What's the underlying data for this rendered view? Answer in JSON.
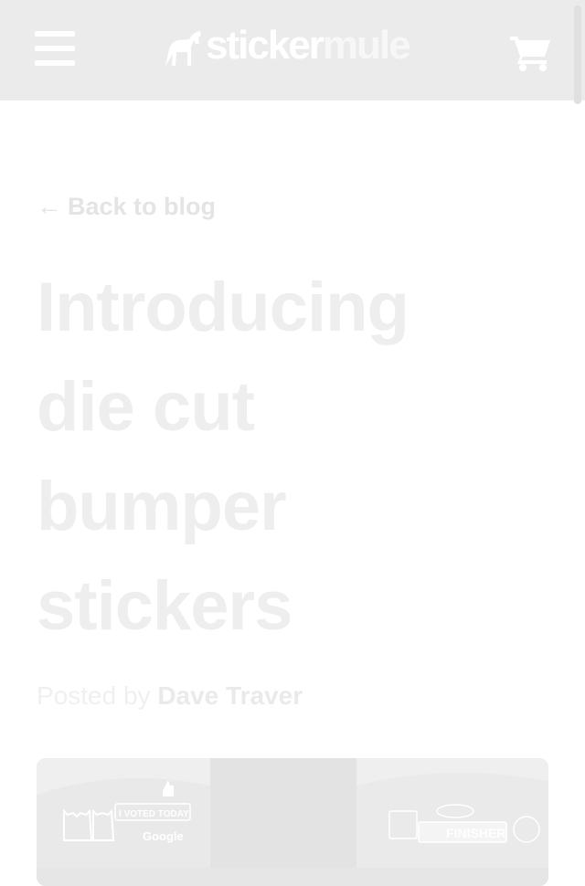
{
  "header": {
    "logo": {
      "part1": "sticker",
      "part2": "mule"
    },
    "menu_icon": "hamburger-menu-icon",
    "cart_icon": "shopping-cart-icon"
  },
  "article": {
    "back_link": {
      "arrow": "←",
      "label": "Back to blog"
    },
    "title_lines": [
      "Introducing",
      "die cut",
      "bumper",
      "stickers"
    ],
    "byline": {
      "prefix": "Posted by ",
      "author": "Dave Traver"
    }
  },
  "hero_image": {
    "sticker_texts": [
      "I VOTED TODAY",
      "Google",
      "FINISHER"
    ]
  },
  "colors": {
    "header_bg": "#ebebeb",
    "text_faded": "#e4e4e4"
  }
}
